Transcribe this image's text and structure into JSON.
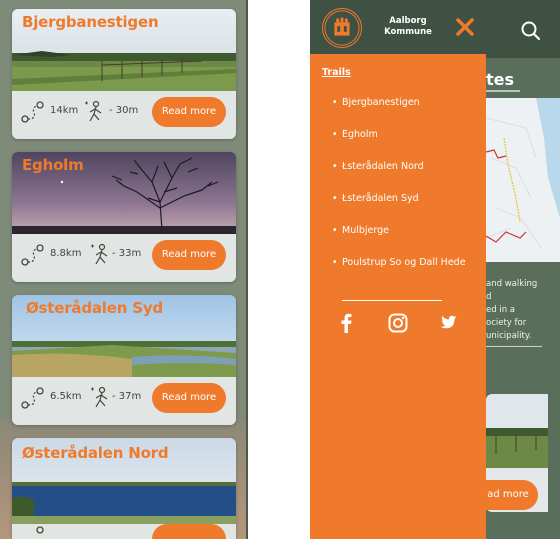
{
  "trails": [
    {
      "name": "Bjergbanestigen",
      "distance": "14km",
      "ascent": "30m",
      "button": "Read more"
    },
    {
      "name": "Egholm",
      "distance": "8.8km",
      "ascent": "33m",
      "button": "Read more"
    },
    {
      "name": "Østerådalen Syd",
      "distance": "6.5km",
      "ascent": "37m",
      "button": "Read more"
    },
    {
      "name": "Østerådalen Nord",
      "distance": "",
      "ascent": "",
      "button": ""
    }
  ],
  "menu": {
    "brand_line1": "Aalborg",
    "brand_line2": "Kommune",
    "section_title": "Trails",
    "items": [
      "Bjergbanestigen",
      "Egholm",
      "Łsterådalen Nord",
      "Łsterådalen Syd",
      "Mulbjerge",
      "Poulstrup So og Dall Hede"
    ]
  },
  "background": {
    "heading_fragment": "tes",
    "text_lines": [
      "and walking",
      "d",
      "ed in a",
      "ociety for",
      "unicipality."
    ],
    "card_button": "ad more"
  },
  "colors": {
    "accent": "#ef7a2c",
    "header": "#3f5142",
    "card_strip": "#e8ecec"
  },
  "icons": [
    "route-icon",
    "hiker-icon",
    "search-icon",
    "close-icon",
    "facebook-icon",
    "instagram-icon",
    "twitter-icon",
    "logo-emblem"
  ]
}
